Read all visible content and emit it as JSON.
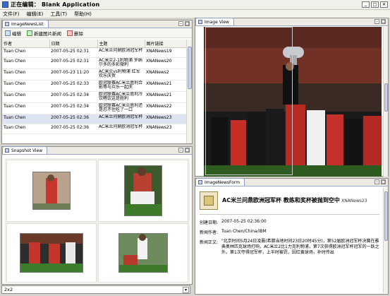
{
  "window": {
    "title": "正在编辑： Blank Application",
    "icon": "app-icon",
    "controls": [
      "minimize-icon",
      "maximize-icon",
      "close-icon"
    ]
  },
  "menubar": {
    "items": [
      {
        "label": "文件(F)"
      },
      {
        "label": "编辑(E)"
      },
      {
        "label": "工具(T)"
      },
      {
        "label": "帮助(H)"
      }
    ]
  },
  "news_list": {
    "tab_label": "ImageNewsList",
    "toolbar": [
      {
        "label": "编辑",
        "icon": "edit-icon"
      },
      {
        "label": "新建图片新闻",
        "icon": "new-icon"
      },
      {
        "label": "删除",
        "icon": "delete-icon"
      }
    ],
    "columns": [
      "作者",
      "日期",
      "主题",
      "图片链接"
    ],
    "rows": [
      {
        "author": "Tuan Chen",
        "date": "2007-05-25 02:31",
        "subject": "AC米兰问鼎欧洲冠军杯",
        "link": "XNANews19"
      },
      {
        "author": "Tuan Chen",
        "date": "2007-05-25 02:31",
        "subject": "AC米兰2-1利物浦 罗纳尔多的多彩微利",
        "link": "XNANews20"
      },
      {
        "author": "Tuan Chen",
        "date": "2007-05-23 11:20",
        "subject": "AC米兰vs利物浦 红军欢乐庆贺",
        "link": "XNANews2"
      },
      {
        "author": "Tuan Chen",
        "date": "2007-05-25 02:33",
        "subject": "欧冠联赛AC米兰胜利合影等与众乐一起庆",
        "link": "XNANews21"
      },
      {
        "author": "Tuan Chen",
        "date": "2007-05-25 02:34",
        "subject": "欧冠联赛AC米兰胜利冷饮畅饮这是胜利",
        "link": "XNANews21"
      },
      {
        "author": "Tuan Chen",
        "date": "2007-05-25 02:34",
        "subject": "欧冠联赛AC米兰胜利还是忍不住吃了一口",
        "link": "XNANews22"
      },
      {
        "author": "Tuan Chen",
        "date": "2007-05-25 02:36",
        "subject": "AC米兰问鼎欧洲冠军杯",
        "link": "XNANews23"
      },
      {
        "author": "Tuan Chen",
        "date": "2007-05-25 02:36",
        "subject": "AC米兰问鼎欧洲冠军杯",
        "link": "XNANews23"
      }
    ],
    "selected_index": 6
  },
  "snapshot": {
    "tab_label": "Snapshot View",
    "thumbnails": [
      {
        "name": "snapshot-1"
      },
      {
        "name": "snapshot-2"
      },
      {
        "name": "snapshot-3"
      },
      {
        "name": "snapshot-4"
      }
    ]
  },
  "status": {
    "text": "2x2"
  },
  "image_view": {
    "tab_label": "Image View"
  },
  "form": {
    "tab_label": "ImageNewsForm",
    "headline": "AC米兰问鼎欧洲冠军杯 教练和奖杯被抛到空中",
    "headline_tag": "XNANews23",
    "fields": [
      {
        "label": "创建日期:",
        "value": "2007-05-25 02:36:00"
      },
      {
        "label": "新闻作者:",
        "value": "Tuan Chen/China/IBM"
      },
      {
        "label": "新闻正文:",
        "value": "\"北京时间5月24日凌晨(希腊当地时间23日20时45分)，第52届欧洲冠军杯决赛在雅典奥林匹克球场打响，AC米兰2比1力克利物浦，第7次获得欧洲冠军杯冠军的一跃之外。第1次夺得冠军杯，上半时被罚，因红黄球场，补时传出"
      }
    ]
  },
  "colors": {
    "accent": "#2e54a8",
    "panel_border": "#8e8d86",
    "selection": "#dde4f2"
  }
}
